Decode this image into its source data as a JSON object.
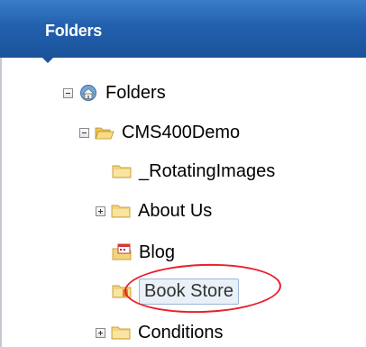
{
  "header": {
    "title": "Folders"
  },
  "tree": {
    "root": {
      "label": "Folders",
      "icon": "home-globe-icon",
      "expanded": true
    },
    "cms": {
      "label": "CMS400Demo",
      "icon": "open-folder-icon",
      "expanded": true
    },
    "items": [
      {
        "label": "_RotatingImages",
        "icon": "folder-icon"
      },
      {
        "label": "About Us",
        "icon": "folder-icon",
        "expandable": true
      },
      {
        "label": "Blog",
        "icon": "blog-calendar-folder-icon"
      },
      {
        "label": "Book Store",
        "icon": "store-folder-icon",
        "selected": true
      },
      {
        "label": "Conditions",
        "icon": "folder-icon",
        "expandable": true
      }
    ]
  },
  "annotation": {
    "color": "#e8202a"
  },
  "colors": {
    "header": "#2260ad",
    "selection_bg": "#e9f0f8",
    "selection_border": "#9fb6d4"
  }
}
